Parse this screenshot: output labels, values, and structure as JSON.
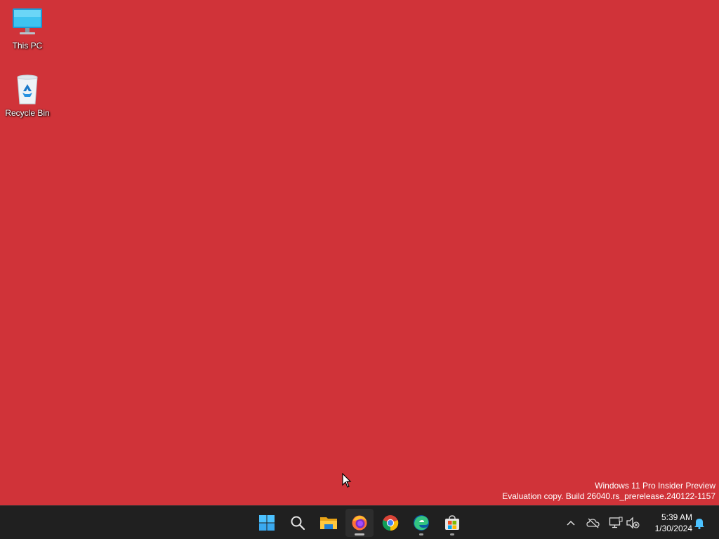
{
  "desktop": {
    "background_color": "#d03339",
    "icons": [
      {
        "label": "This PC",
        "icon": "monitor-icon"
      },
      {
        "label": "Recycle Bin",
        "icon": "recycle-bin-icon"
      }
    ]
  },
  "watermark": {
    "line1": "Windows 11 Pro Insider Preview",
    "line2": "Evaluation copy. Build 26040.rs_prerelease.240122-1157"
  },
  "taskbar": {
    "apps": [
      {
        "name": "Start",
        "icon": "windows-start-icon"
      },
      {
        "name": "Search",
        "icon": "search-icon"
      },
      {
        "name": "File Explorer",
        "icon": "folder-icon"
      },
      {
        "name": "Firefox",
        "icon": "firefox-icon",
        "active": true
      },
      {
        "name": "Google Chrome",
        "icon": "chrome-icon"
      },
      {
        "name": "Microsoft Edge",
        "icon": "edge-icon",
        "running": true
      },
      {
        "name": "Microsoft Store",
        "icon": "store-icon",
        "running": true
      }
    ],
    "tray": {
      "icons": [
        "chevron-up-icon",
        "onedrive-offline-icon",
        "network-icon",
        "volume-muted-icon",
        "bell-icon"
      ],
      "time": "5:39 AM",
      "date": "1/30/2024"
    }
  }
}
